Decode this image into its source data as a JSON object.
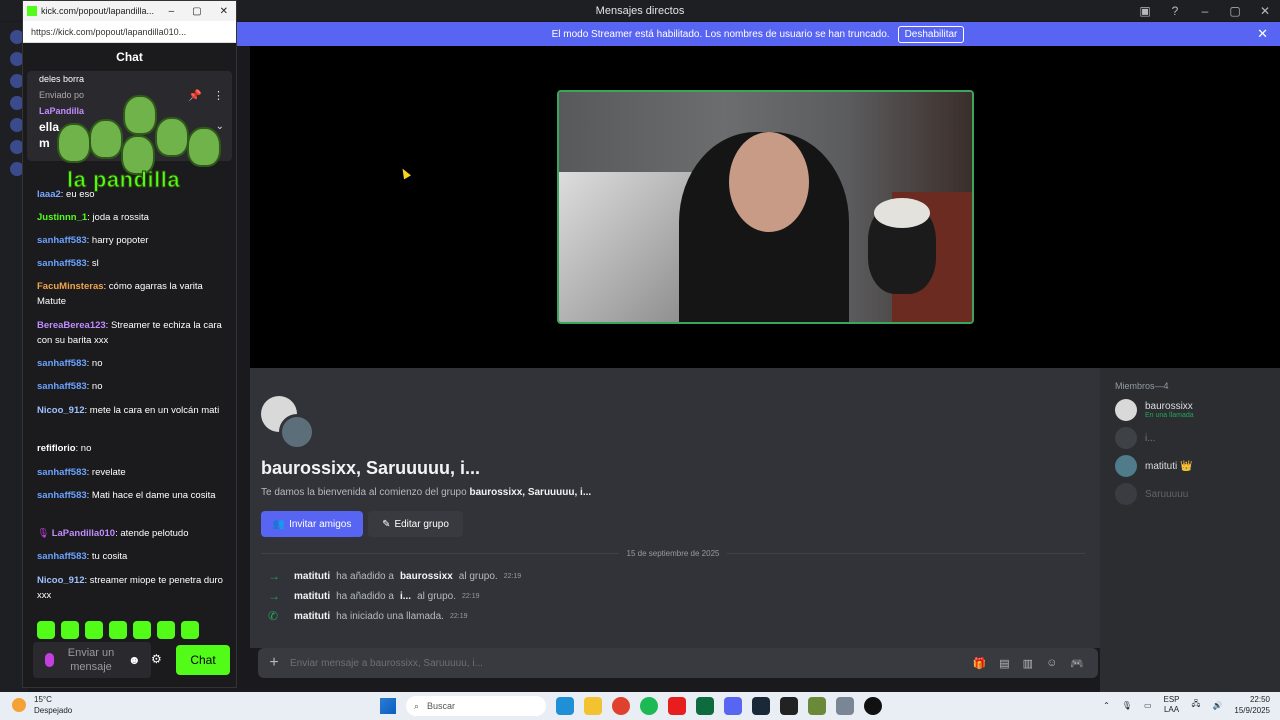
{
  "window": {
    "title": "Mensajes directos"
  },
  "banner": {
    "text": "El modo Streamer está habilitado. Los nombres de usuario se han truncado.",
    "button": "Deshabilitar"
  },
  "group": {
    "title": "baurossixx, Saruuuuu, i...",
    "welcome_prefix": "Te damos la bienvenida al comienzo del grupo",
    "welcome_group": "baurossixx, Saruuuuu, i...",
    "invite_button": "Invitar amigos",
    "edit_button": "Editar grupo",
    "date_divider": "15 de septiembre de 2025",
    "messages": [
      {
        "user": "matituti",
        "action": "ha añadido a",
        "target": "baurossixx",
        "rest": "al grupo.",
        "time": "22:19"
      },
      {
        "user": "matituti",
        "action": "ha añadido a",
        "target": "i...",
        "rest": "al grupo.",
        "time": "22:19"
      },
      {
        "user": "matituti",
        "action": "ha iniciado una llamada.",
        "target": "",
        "rest": "",
        "time": "22:19"
      }
    ],
    "input_placeholder": "Enviar mensaje a baurossixx, Saruuuuu, i..."
  },
  "members": {
    "title": "Miembros—4",
    "list": [
      {
        "name": "baurossixx",
        "status": "En una llamada"
      },
      {
        "name": "i...",
        "status": ""
      },
      {
        "name": "matituti 👑",
        "status": ""
      },
      {
        "name": "Saruuuuu",
        "status": ""
      }
    ]
  },
  "kick": {
    "window_title": "kick.com/popout/lapandilla...",
    "url": "https://kick.com/popout/lapandilla010...",
    "header": "Chat",
    "overlay_text": "la pandilla",
    "pinned": {
      "line1": "deles borra",
      "line2": "Enviado po",
      "user": "LaPandilla",
      "line3": "ella",
      "line4": "m"
    },
    "messages": [
      {
        "user": "laaa2",
        "text": ": eu   eso",
        "color": "#7aa8ff"
      },
      {
        "user": "Justinnn_1",
        "text": ": joda a rossita",
        "color": "#53fc18"
      },
      {
        "user": "sanhaff583",
        "text": ": harry popoter",
        "color": "#6aa2ff"
      },
      {
        "user": "sanhaff583",
        "text": ": sl",
        "color": "#6aa2ff"
      },
      {
        "user": "FacuMinsteras",
        "text": ": cómo agarras la varita Matute",
        "color": "#f0a44a"
      },
      {
        "user": "BereaBerea123",
        "text": ": Streamer te echiza la cara con su barita xxx",
        "color": "#c08cff"
      },
      {
        "user": "sanhaff583",
        "text": ": no",
        "color": "#6aa2ff"
      },
      {
        "user": "sanhaff583",
        "text": ": no",
        "color": "#6aa2ff"
      },
      {
        "user": "Nicoo_912",
        "text": ": mete la cara en un volcán mati",
        "color": "#9fc1ff"
      },
      {
        "user": "refiflorio",
        "text": ": no",
        "color": "#ffffff"
      },
      {
        "user": "sanhaff583",
        "text": ": revelate",
        "color": "#6aa2ff"
      },
      {
        "user": "sanhaff583",
        "text": ": Mati hace el dame una cosita",
        "color": "#6aa2ff"
      },
      {
        "user": "LaPandilla010",
        "text": ": atende pelotudo",
        "color": "#c08cff"
      },
      {
        "user": "sanhaff583",
        "text": ": tu cosita",
        "color": "#6aa2ff"
      },
      {
        "user": "Nicoo_912",
        "text": ": streamer miope te penetra duro xxx",
        "color": "#9fc1ff"
      }
    ],
    "input_placeholder": "Enviar un mensaje",
    "send_button": "Chat"
  },
  "taskbar": {
    "weather_temp": "15°C",
    "weather_desc": "Despejado",
    "search": "Buscar",
    "lang": "ESP",
    "lang2": "LAA",
    "time": "22:50",
    "date": "15/9/2025"
  },
  "colors": {
    "accent": "#5865f2",
    "kick_green": "#53fc18",
    "video_border": "#3ba55c"
  }
}
